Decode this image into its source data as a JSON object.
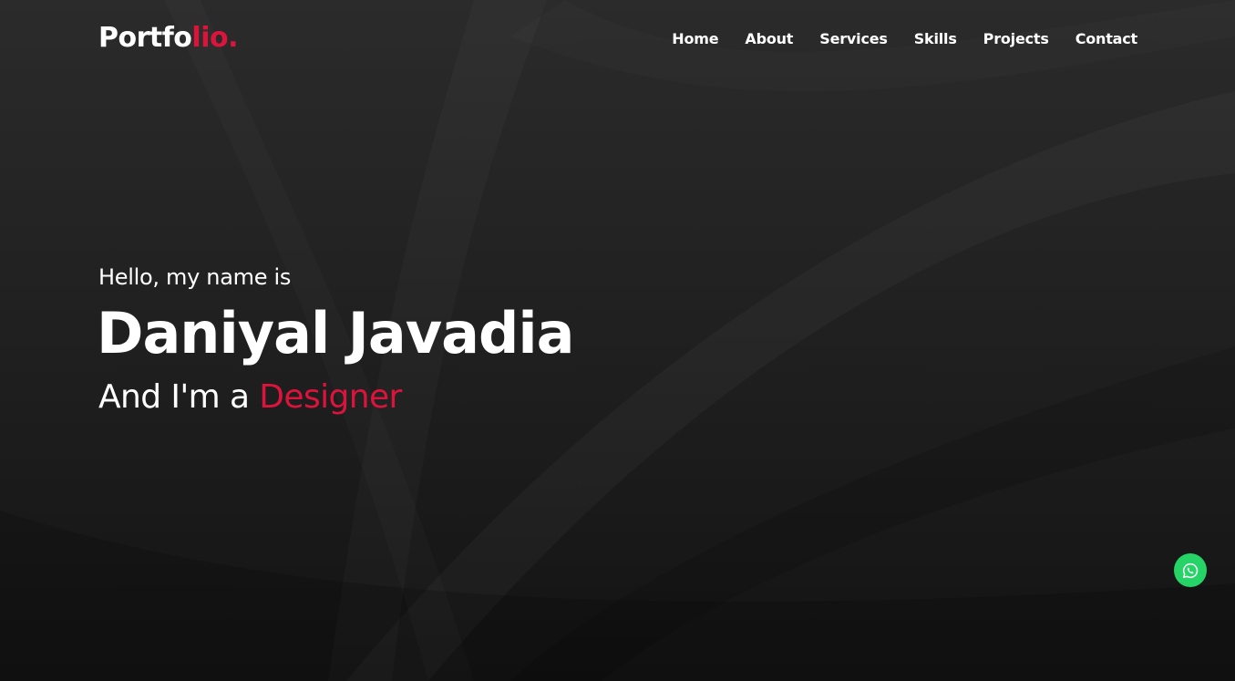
{
  "brand": {
    "logo_main": "Portfo",
    "logo_accent": "lio.",
    "accent_color": "#dc143c"
  },
  "nav": {
    "items": [
      {
        "label": "Home"
      },
      {
        "label": "About"
      },
      {
        "label": "Services"
      },
      {
        "label": "Skills"
      },
      {
        "label": "Projects"
      },
      {
        "label": "Contact"
      }
    ]
  },
  "hero": {
    "greeting": "Hello, my name is",
    "name": "Daniyal Javadia",
    "role_prefix": "And I'm a ",
    "role_highlight": "Designer"
  },
  "floating": {
    "icon": "whatsapp-icon",
    "color": "#25d366"
  }
}
